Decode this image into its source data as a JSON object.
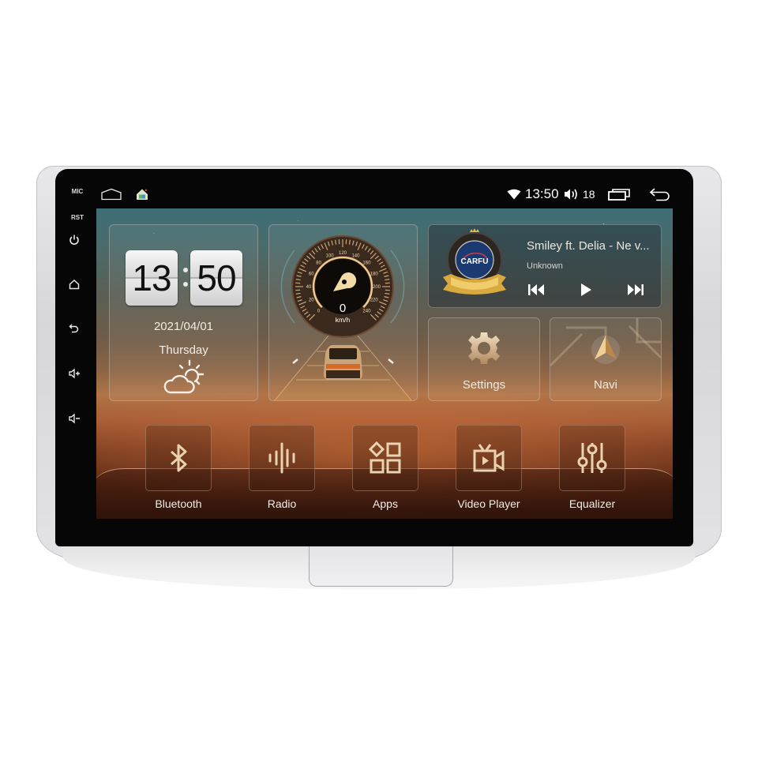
{
  "device": {
    "side_labels": {
      "mic": "MIC",
      "rst": "RST"
    },
    "side_buttons": [
      {
        "name": "power",
        "icon": "power-icon"
      },
      {
        "name": "home",
        "icon": "home-icon"
      },
      {
        "name": "back",
        "icon": "back-icon"
      },
      {
        "name": "volume-up",
        "icon": "volume-up-icon"
      },
      {
        "name": "volume-down",
        "icon": "volume-down-icon"
      }
    ]
  },
  "statusbar": {
    "left_icons": [
      "home-outline-icon",
      "launcher-house-icon"
    ],
    "wifi_icon": "wifi-icon",
    "time": "13:50",
    "volume_icon": "speaker-icon",
    "volume_level": "18",
    "recents_icon": "recent-apps-icon",
    "back_icon": "back-arrow-icon"
  },
  "clock_widget": {
    "hours": "13",
    "minutes": "50",
    "date": "2021/04/01",
    "weekday": "Thursday",
    "weather_icon": "partly-cloudy-icon"
  },
  "speed_widget": {
    "speed": "0",
    "unit": "km/h",
    "scale_labels": [
      "0",
      "20",
      "40",
      "60",
      "80",
      "100",
      "120",
      "140",
      "160",
      "180",
      "200",
      "220",
      "240"
    ],
    "speed_fraction": 0
  },
  "music_widget": {
    "logo_text": "CARFU",
    "title": "Smiley ft. Delia - Ne v...",
    "artist": "Unknown",
    "controls": [
      "previous-icon",
      "play-icon",
      "next-icon"
    ]
  },
  "tiles": [
    {
      "label": "Settings",
      "icon": "gear-icon"
    },
    {
      "label": "Navi",
      "icon": "navigation-arrow-icon"
    }
  ],
  "dock": [
    {
      "label": "Bluetooth",
      "icon": "bluetooth-icon"
    },
    {
      "label": "Radio",
      "icon": "radio-waves-icon"
    },
    {
      "label": "Apps",
      "icon": "apps-grid-icon"
    },
    {
      "label": "Video Player",
      "icon": "video-player-icon"
    },
    {
      "label": "Equalizer",
      "icon": "equalizer-icon"
    }
  ],
  "colors": {
    "accent_gold": "#e8c79a",
    "icon_cream": "#e9d2b0"
  }
}
